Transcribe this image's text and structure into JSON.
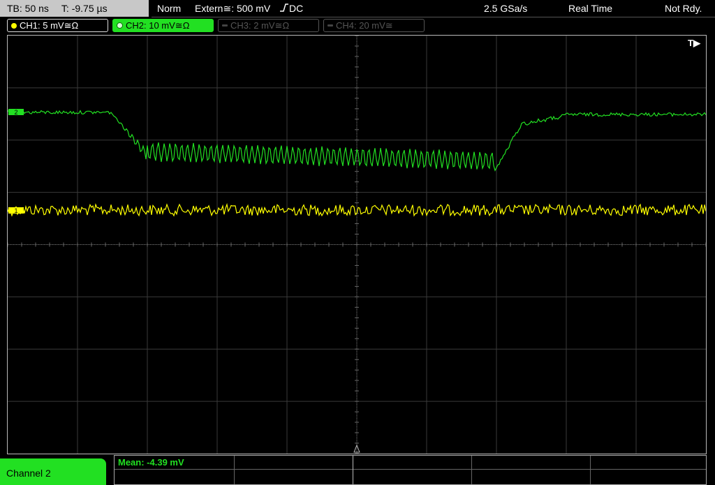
{
  "status": {
    "timebase": "TB: 50 ns",
    "trigger_time": "T: -9.75 µs",
    "mode": "Norm",
    "trigger_source": "Extern≅: 500 mV",
    "coupling": "DC",
    "sample_rate": "2.5 GSa/s",
    "acq_mode": "Real Time",
    "state": "Not Rdy."
  },
  "channels": [
    {
      "label": "CH1: 5 mV≅Ω",
      "color": "#ffff00",
      "active": true
    },
    {
      "label": "CH2: 10 mV≅Ω",
      "color": "#22e022",
      "active": true,
      "selected": true
    },
    {
      "label": "CH3: 2 mV≅Ω",
      "color": "#555555",
      "active": false
    },
    {
      "label": "CH4: 20 mV≅",
      "color": "#555555",
      "active": false
    }
  ],
  "plot": {
    "trigger_marker": "T▶",
    "ch2_marker": "2",
    "ch1_marker": "1"
  },
  "bottom": {
    "channel_tab": "Channel 2",
    "measurement": "Mean: -4.39 mV"
  }
}
